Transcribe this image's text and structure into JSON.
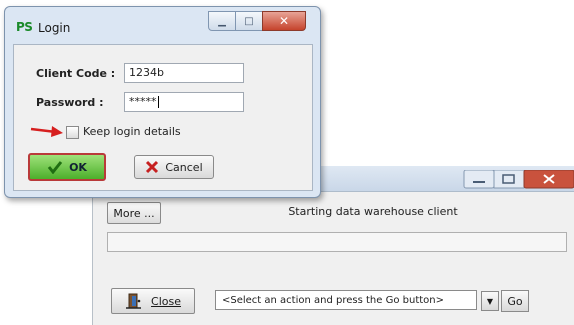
{
  "login_dialog": {
    "app_logo": "PS",
    "title": "Login",
    "client_code_label": "Client Code :",
    "client_code_value": "1234b",
    "password_label": "Password :",
    "password_value": "*****",
    "keep_login_label": "Keep login details",
    "keep_login_checked": false,
    "ok_label": "OK",
    "cancel_label": "Cancel",
    "window_controls": [
      "minimize-icon",
      "maximize-icon",
      "close-icon"
    ]
  },
  "client_window": {
    "more_label": "More ...",
    "status_text": "Starting data warehouse client",
    "progress": 0,
    "close_label": "Close",
    "action_select_value": "<Select an action and press the Go button>",
    "go_label": "Go",
    "window_controls": [
      "minimize-icon",
      "maximize-icon",
      "close-icon"
    ]
  },
  "colors": {
    "ok_green": "#4caf2b",
    "ok_border": "#b93a3a",
    "arrow_red": "#d61f1f",
    "cancel_x_red": "#c62020",
    "window_frame": "#dbe6f3"
  }
}
